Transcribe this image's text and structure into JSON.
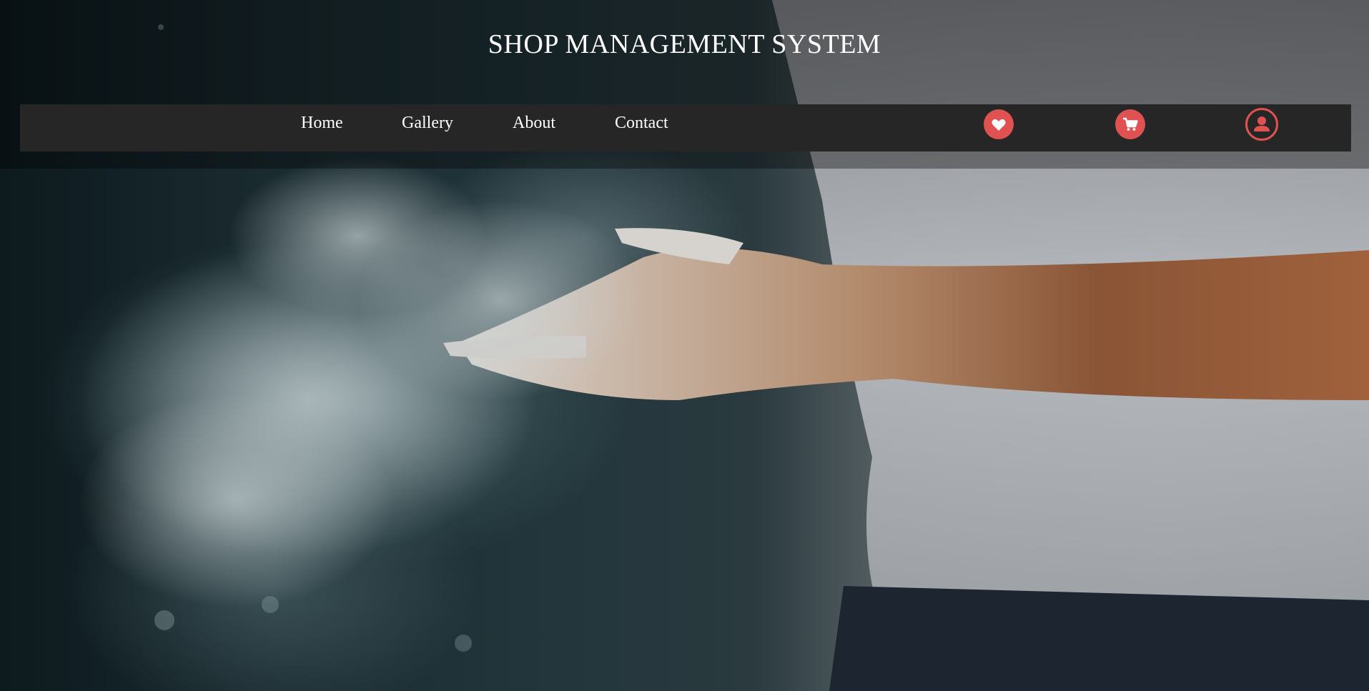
{
  "header": {
    "title": "SHOP MANAGEMENT SYSTEM"
  },
  "nav": {
    "links": [
      {
        "label": "Home"
      },
      {
        "label": "Gallery"
      },
      {
        "label": "About"
      },
      {
        "label": "Contact"
      }
    ],
    "icons": [
      {
        "name": "heart-icon"
      },
      {
        "name": "cart-icon"
      },
      {
        "name": "user-icon"
      }
    ]
  },
  "colors": {
    "accent": "#e05252",
    "navbar_bg": "#262626",
    "text": "#ffffff"
  }
}
